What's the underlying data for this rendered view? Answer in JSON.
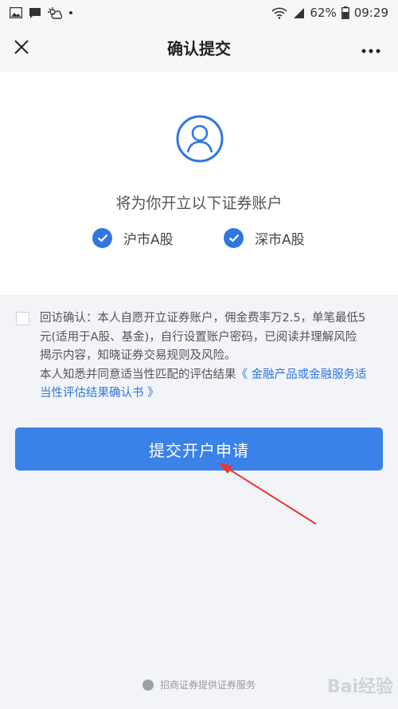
{
  "status_bar": {
    "battery": "62%",
    "time": "09:29",
    "icons": [
      "image-icon",
      "message-icon",
      "weather-icon",
      "dot-icon",
      "wifi-icon",
      "signal-icon",
      "battery-icon"
    ]
  },
  "nav": {
    "title": "确认提交",
    "close_icon": "close-icon",
    "more_icon": "more-icon"
  },
  "account": {
    "heading": "将为你开立以下证券账户",
    "options": [
      {
        "label": "沪市A股",
        "checked": true
      },
      {
        "label": "深市A股",
        "checked": true
      }
    ]
  },
  "agreement": {
    "checked": false,
    "line1": "回访确认：本人自愿开立证券账户，佣金费率万2.5，单笔最低5",
    "line2": "元(适用于A股、基金)，自行设置账户密码，已阅读并理解风险",
    "line3": "揭示内容，知晓证券交易规则及风险。",
    "line4_prefix": "本人知悉并同意适当性匹配的评估结果",
    "line4_link": "《 金融产品或金融服务适",
    "line5_link": "当性评估结果确认书 》"
  },
  "submit_label": "提交开户申请",
  "footer_text": "招商证券提供证券服务",
  "watermark": "Bai经验",
  "colors": {
    "accent": "#3b82e8",
    "link": "#2f76e0",
    "annotation_arrow": "#e8372c"
  }
}
